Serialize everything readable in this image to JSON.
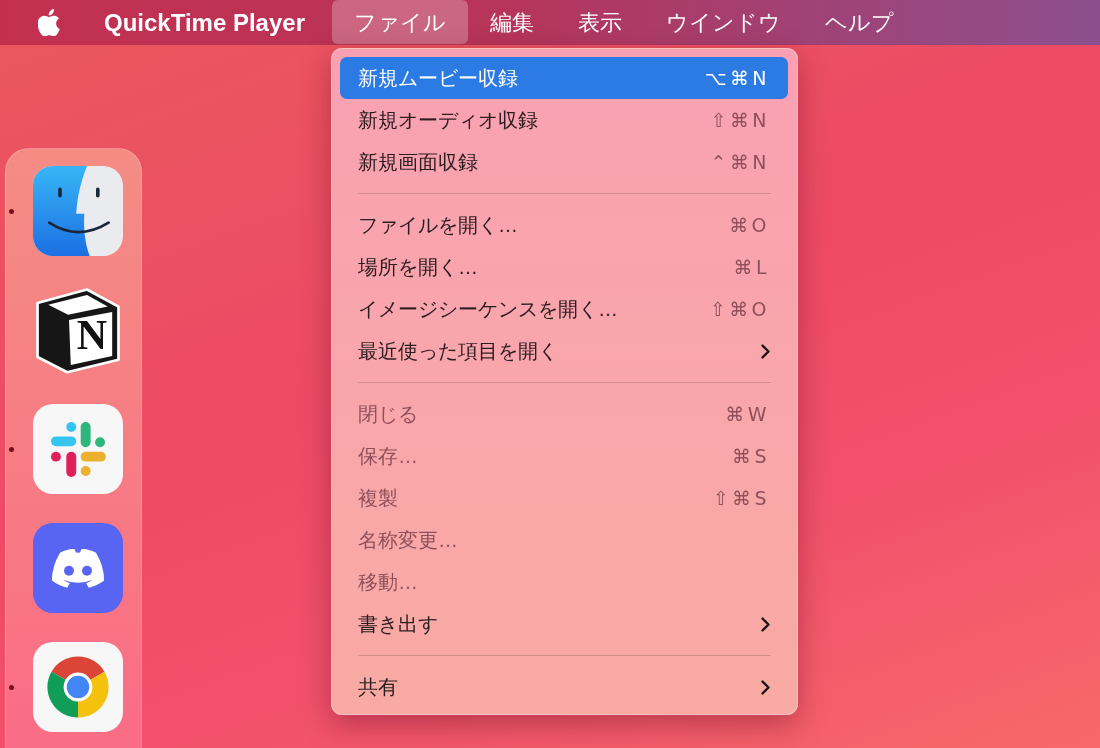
{
  "menu_bar": {
    "app_name": "QuickTime Player",
    "menus": [
      {
        "label": "ファイル",
        "selected": true
      },
      {
        "label": "編集",
        "selected": false
      },
      {
        "label": "表示",
        "selected": false
      },
      {
        "label": "ウインドウ",
        "selected": false
      },
      {
        "label": "ヘルプ",
        "selected": false
      }
    ]
  },
  "file_menu": {
    "groups": [
      {
        "items": [
          {
            "label": "新規ムービー収録",
            "shortcut": "⌥⌘N",
            "submenu": false,
            "selected": true,
            "disabled": false
          },
          {
            "label": "新規オーディオ収録",
            "shortcut": "⇧⌘N",
            "submenu": false,
            "selected": false,
            "disabled": false
          },
          {
            "label": "新規画面収録",
            "shortcut": "⌃⌘N",
            "submenu": false,
            "selected": false,
            "disabled": false
          }
        ]
      },
      {
        "items": [
          {
            "label": "ファイルを開く…",
            "shortcut": "⌘O",
            "submenu": false,
            "selected": false,
            "disabled": false
          },
          {
            "label": "場所を開く…",
            "shortcut": "⌘L",
            "submenu": false,
            "selected": false,
            "disabled": false
          },
          {
            "label": "イメージシーケンスを開く…",
            "shortcut": "⇧⌘O",
            "submenu": false,
            "selected": false,
            "disabled": false
          },
          {
            "label": "最近使った項目を開く",
            "submenu": true,
            "selected": false,
            "disabled": false
          }
        ]
      },
      {
        "items": [
          {
            "label": "閉じる",
            "shortcut": "⌘W",
            "submenu": false,
            "selected": false,
            "disabled": true
          },
          {
            "label": "保存…",
            "shortcut": "⌘S",
            "submenu": false,
            "selected": false,
            "disabled": true
          },
          {
            "label": "複製",
            "shortcut": "⇧⌘S",
            "submenu": false,
            "selected": false,
            "disabled": true
          },
          {
            "label": "名称変更…",
            "submenu": false,
            "selected": false,
            "disabled": true
          },
          {
            "label": "移動…",
            "submenu": false,
            "selected": false,
            "disabled": true
          },
          {
            "label": "書き出す",
            "submenu": true,
            "selected": false,
            "disabled": false
          }
        ]
      },
      {
        "items": [
          {
            "label": "共有",
            "submenu": true,
            "selected": false,
            "disabled": false
          }
        ]
      }
    ]
  },
  "dock": {
    "apps": [
      {
        "kind": "face",
        "running": true
      },
      {
        "kind": "cube",
        "letter": "N",
        "running": false
      },
      {
        "kind": "hash",
        "running": true
      },
      {
        "kind": "controller",
        "running": false
      },
      {
        "kind": "wheel",
        "running": true
      }
    ]
  }
}
